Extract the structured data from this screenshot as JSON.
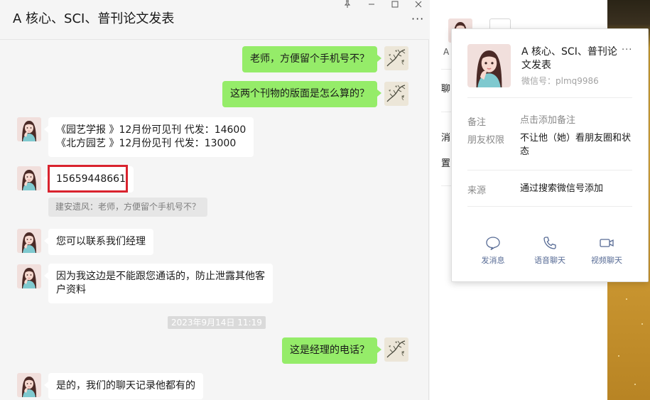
{
  "chat": {
    "title": "A 核心、SCI、普刊论文发表",
    "more_label": "···",
    "messages": [
      {
        "side": "out",
        "text": "老师，方便留个手机号不？"
      },
      {
        "side": "out",
        "text": "这两个刊物的版面是怎么算的？"
      },
      {
        "side": "in",
        "lines": [
          "《园艺学报 》12月份可见刊 代发：14600",
          "《北方园艺 》12月份见刊  代发：13000"
        ]
      },
      {
        "side": "in",
        "text": "15659448661"
      },
      {
        "quote": "建安遗风：老师，方便留个手机号不？"
      },
      {
        "side": "in",
        "text": "您可以联系我们经理"
      },
      {
        "side": "in",
        "lines": [
          "因为我这边是不能跟您通话的，防止泄露其他客",
          "户资料"
        ]
      },
      {
        "timestamp": "2023年9月14日 11:19"
      },
      {
        "side": "out",
        "text": "这是经理的电话？"
      },
      {
        "side": "in",
        "text": "是的，我们的聊天记录他都有的"
      }
    ]
  },
  "mid_panel": {
    "name_initial": "A",
    "item1": "聊",
    "item2": "消",
    "item3": "置"
  },
  "profile": {
    "name": "A 核心、SCI、普刊论文发表",
    "wxid": "微信号：plmq9986",
    "more_label": "···",
    "remark_label": "备注",
    "remark_value": "点击添加备注",
    "perm_label": "朋友权限",
    "perm_value": "不让他（她）看朋友圈和状态",
    "source_label": "来源",
    "source_value": "通过搜索微信号添加",
    "actions": [
      {
        "label": "发消息",
        "icon": "chat-bubble-icon"
      },
      {
        "label": "语音聊天",
        "icon": "phone-icon"
      },
      {
        "label": "视频聊天",
        "icon": "video-camera-icon"
      }
    ]
  },
  "colors": {
    "out_bubble": "#95ec69",
    "in_bubble": "#ffffff",
    "highlight_border": "#d9232e",
    "link": "#576b95"
  }
}
